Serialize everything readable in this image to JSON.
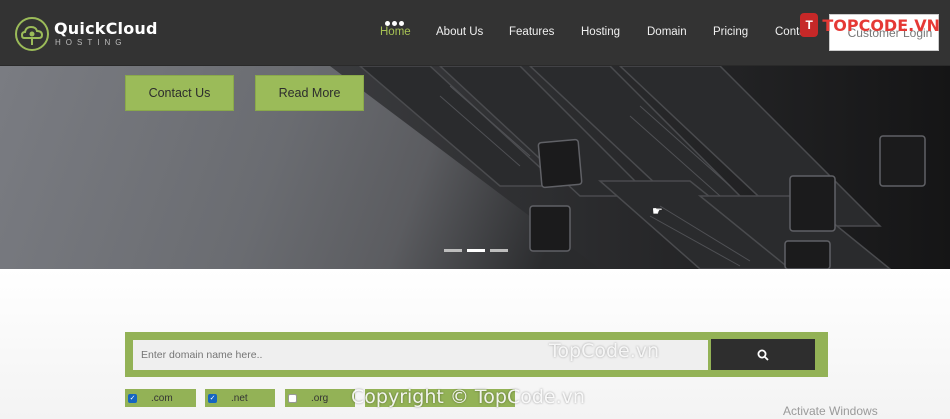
{
  "brand": {
    "name": "QuickCloud",
    "tagline": "HOSTING"
  },
  "nav": {
    "items": [
      {
        "label": "Home",
        "active": true
      },
      {
        "label": "About Us",
        "active": false
      },
      {
        "label": "Features",
        "active": false
      },
      {
        "label": "Hosting",
        "active": false
      },
      {
        "label": "Domain",
        "active": false
      },
      {
        "label": "Pricing",
        "active": false
      },
      {
        "label": "Conta",
        "active": false
      }
    ],
    "login_label": "Customer Login"
  },
  "watermark_logo": {
    "badge": "T",
    "text": "TOPCODE.VN"
  },
  "hero": {
    "buttons": {
      "contact": "Contact Us",
      "read_more": "Read More"
    },
    "slide_count": 3,
    "active_slide": 2
  },
  "domain_search": {
    "placeholder": "Enter domain name here..",
    "extensions": [
      {
        "label": ".com",
        "checked": true
      },
      {
        "label": ".net",
        "checked": true
      },
      {
        "label": ".org",
        "checked": false
      }
    ]
  },
  "overlays": {
    "site_watermark": "TopCode.vn",
    "copyright_watermark": "Copyright © TopCode.vn",
    "os_notice": "Activate Windows"
  },
  "colors": {
    "header_bg": "#333333",
    "accent_green": "#9bbb59",
    "search_frame": "#93b256",
    "search_button": "#2e2e2e"
  }
}
